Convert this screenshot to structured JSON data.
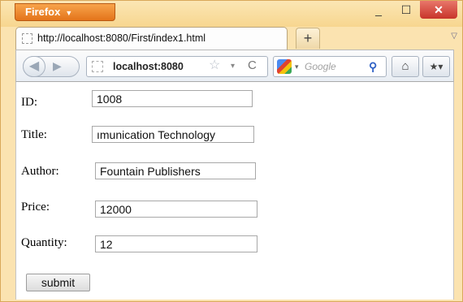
{
  "browser": {
    "menu_button": "Firefox",
    "menu_arrow": "▼",
    "controls": {
      "minimize": "_",
      "maximize": "☐",
      "close": "✕"
    },
    "tab": {
      "title": "http://localhost:8080/First/index1.html"
    },
    "new_tab": "+",
    "tab_list_arrow": "▽",
    "nav": {
      "back_icon": "◀",
      "forward_icon": "▶",
      "url": "localhost:8080",
      "bookmark_star": "☆",
      "history_dropdown": "▾",
      "reload": "C",
      "search_engine_dropdown": "▾",
      "search_placeholder": "Google",
      "search_icon": "⚲",
      "home_icon": "⌂",
      "bookmarks_icon": "★▾"
    }
  },
  "form": {
    "fields": [
      {
        "label": "ID:",
        "value": "1008"
      },
      {
        "label": "Title:",
        "value": "ımunication Technology"
      },
      {
        "label": "Author:",
        "value": "Fountain Publishers"
      },
      {
        "label": "Price:",
        "value": "12000"
      },
      {
        "label": "Quantity:",
        "value": "12"
      }
    ],
    "submit_label": "submit"
  }
}
